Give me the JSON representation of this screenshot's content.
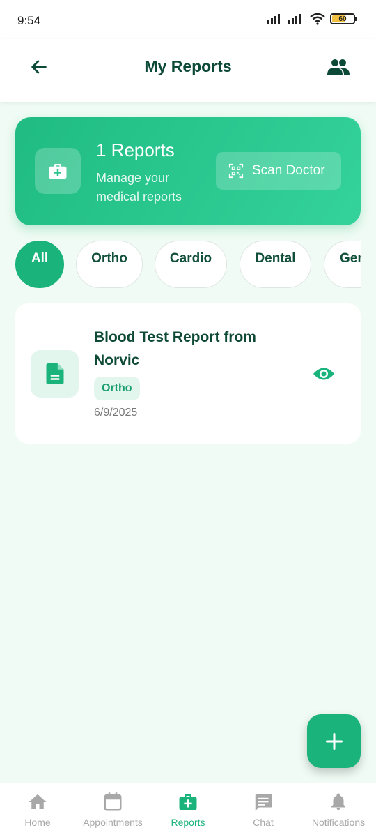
{
  "status_bar": {
    "time": "9:54",
    "battery": "60"
  },
  "header": {
    "title": "My Reports"
  },
  "summary": {
    "count": "1 Reports",
    "subtitle": "Manage your medical reports",
    "scan_label": "Scan Doctor"
  },
  "filters": [
    "All",
    "Ortho",
    "Cardio",
    "Dental",
    "Ger"
  ],
  "reports": [
    {
      "title": "Blood Test Report from Norvic",
      "tag": "Ortho",
      "date": "6/9/2025"
    }
  ],
  "nav": [
    "Home",
    "Appointments",
    "Reports",
    "Chat",
    "Notifications"
  ],
  "colors": {
    "accent": "#1ab37c",
    "title_dark": "#0c4a37",
    "background": "#effbf4"
  }
}
